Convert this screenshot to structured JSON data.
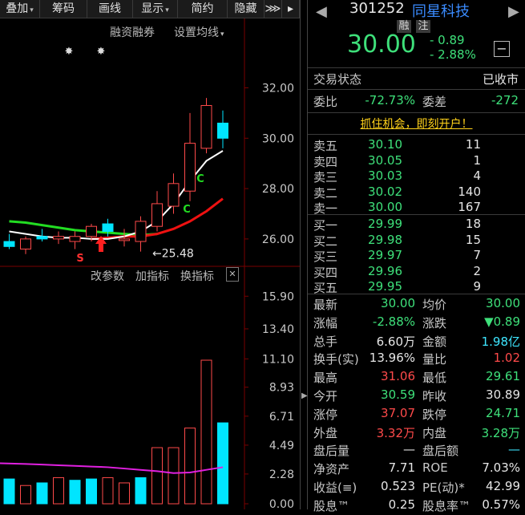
{
  "toolbar": {
    "items": [
      {
        "label": "叠加",
        "caret": "▾",
        "w": 50
      },
      {
        "label": "筹码",
        "caret": "",
        "w": 59
      },
      {
        "label": "画线",
        "caret": "",
        "w": 57
      },
      {
        "label": "显示",
        "caret": "▾",
        "w": 56
      },
      {
        "label": "简约",
        "caret": "",
        "w": 62
      },
      {
        "label": "隐藏",
        "caret": "",
        "w": 46
      },
      {
        "label": "⋙",
        "caret": "",
        "w": 22
      },
      {
        "label": "▸",
        "caret": "",
        "w": 22
      }
    ]
  },
  "chart_links": {
    "margin": "融资融券",
    "ma_setting": "设置均线",
    "ma_caret": "▾",
    "params": "改参数",
    "add_ind": "加指标",
    "swap_ind": "换指标",
    "close": "✕"
  },
  "chart_data": [
    {
      "type": "candlestick",
      "y_ticks": [
        "32.00",
        "30.00",
        "28.00",
        "26.00"
      ],
      "ylim": [
        25.2,
        33.8
      ],
      "annotation": "←25.48",
      "markers": [
        "✸",
        "✸",
        "S",
        "C",
        "C"
      ],
      "candles": [
        {
          "o": 25.9,
          "h": 26.2,
          "l": 25.6,
          "c": 25.7
        },
        {
          "o": 25.6,
          "h": 26.1,
          "l": 25.4,
          "c": 26.0
        },
        {
          "o": 26.1,
          "h": 26.4,
          "l": 25.9,
          "c": 26.0
        },
        {
          "o": 26.0,
          "h": 26.3,
          "l": 25.8,
          "c": 26.1
        },
        {
          "o": 25.9,
          "h": 26.3,
          "l": 25.6,
          "c": 26.1
        },
        {
          "o": 26.1,
          "h": 26.6,
          "l": 25.9,
          "c": 26.5
        },
        {
          "o": 26.6,
          "h": 26.8,
          "l": 26.1,
          "c": 26.3
        },
        {
          "o": 26.0,
          "h": 26.4,
          "l": 25.7,
          "c": 26.0
        },
        {
          "o": 25.9,
          "h": 26.9,
          "l": 25.5,
          "c": 26.7
        },
        {
          "o": 26.5,
          "h": 27.9,
          "l": 26.3,
          "c": 27.4
        },
        {
          "o": 27.3,
          "h": 28.6,
          "l": 27.0,
          "c": 28.2
        },
        {
          "o": 27.9,
          "h": 31.0,
          "l": 27.5,
          "c": 29.8
        },
        {
          "o": 29.6,
          "h": 31.6,
          "l": 29.4,
          "c": 31.3
        },
        {
          "o": 30.6,
          "h": 31.1,
          "l": 29.6,
          "c": 30.0
        }
      ],
      "ma_white": [
        26.3,
        26.2,
        26.1,
        26.05,
        26.05,
        26.0,
        26.0,
        26.1,
        26.3,
        26.7,
        27.4,
        28.3,
        29.1,
        29.5
      ],
      "ma_green": [
        26.7,
        26.65,
        26.55,
        26.45,
        26.35,
        26.3,
        26.25,
        26.2,
        26.15,
        26.2
      ],
      "ma_red": [
        26.0,
        26.05,
        26.1,
        26.1,
        26.2,
        26.4,
        26.7,
        27.1,
        27.6
      ]
    },
    {
      "type": "bar",
      "y_ticks": [
        "15.90",
        "13.40",
        "11.10",
        "8.93",
        "6.71",
        "4.49",
        "2.28",
        "0.00"
      ],
      "ylim": [
        0,
        16.9
      ],
      "volumes": [
        1.9,
        1.4,
        1.6,
        2.0,
        1.8,
        1.9,
        2.0,
        1.6,
        2.0,
        4.3,
        4.3,
        5.8,
        11.0,
        6.2
      ],
      "up": [
        false,
        true,
        false,
        true,
        false,
        false,
        true,
        true,
        false,
        true,
        true,
        true,
        true,
        false
      ],
      "ma_magenta": [
        3.1,
        3.05,
        3.0,
        2.95,
        2.9,
        2.85,
        2.8,
        2.7,
        2.6,
        2.5,
        2.35,
        2.4,
        2.6,
        2.8
      ]
    }
  ],
  "header": {
    "code": "301252",
    "name": "同星科技",
    "badge_margin": "融",
    "badge_note": "注",
    "price": "30.00",
    "change": "- 0.89",
    "change_pct": "- 2.88%",
    "minus_btn": "−"
  },
  "status": {
    "label": "交易状态",
    "value": "已收市"
  },
  "ratio": {
    "wb_label": "委比",
    "wb": "-72.73%",
    "wc_label": "委差",
    "wc": "-272"
  },
  "promo": "抓住机会，即刻开户！",
  "asks": [
    {
      "label": "卖五",
      "price": "30.10",
      "vol": "11"
    },
    {
      "label": "卖四",
      "price": "30.05",
      "vol": "1"
    },
    {
      "label": "卖三",
      "price": "30.03",
      "vol": "4"
    },
    {
      "label": "卖二",
      "price": "30.02",
      "vol": "140"
    },
    {
      "label": "卖一",
      "price": "30.00",
      "vol": "167"
    }
  ],
  "bids": [
    {
      "label": "买一",
      "price": "29.99",
      "vol": "18"
    },
    {
      "label": "买二",
      "price": "29.98",
      "vol": "15"
    },
    {
      "label": "买三",
      "price": "29.97",
      "vol": "7"
    },
    {
      "label": "买四",
      "price": "29.96",
      "vol": "2"
    },
    {
      "label": "买五",
      "price": "29.95",
      "vol": "9"
    }
  ],
  "stats": [
    {
      "l1": "最新",
      "v1": "30.00",
      "c1": "down",
      "l2": "均价",
      "v2": "30.00",
      "c2": "down"
    },
    {
      "l1": "涨幅",
      "v1": "-2.88%",
      "c1": "down",
      "l2": "涨跌",
      "v2": "▼0.89",
      "c2": "down"
    },
    {
      "l1": "总手",
      "v1": "6.60万",
      "c1": "white",
      "l2": "金额",
      "v2": "1.98亿",
      "c2": "cyan"
    },
    {
      "l1": "换手(实)",
      "v1": "13.96%",
      "c1": "white",
      "l2": "量比",
      "v2": "1.02",
      "c2": "up"
    },
    {
      "l1": "最高",
      "v1": "31.06",
      "c1": "up",
      "l2": "最低",
      "v2": "29.61",
      "c2": "down"
    },
    {
      "l1": "今开",
      "v1": "30.59",
      "c1": "down",
      "l2": "昨收",
      "v2": "30.89",
      "c2": "white"
    },
    {
      "l1": "涨停",
      "v1": "37.07",
      "c1": "up",
      "l2": "跌停",
      "v2": "24.71",
      "c2": "down"
    },
    {
      "l1": "外盘",
      "v1": "3.32万",
      "c1": "up",
      "l2": "内盘",
      "v2": "3.28万",
      "c2": "down"
    },
    {
      "l1": "盘后量",
      "v1": "—",
      "c1": "white",
      "l2": "盘后额",
      "v2": "—",
      "c2": "cyan"
    },
    {
      "l1": "净资产",
      "v1": "7.71",
      "c1": "white",
      "l2": "ROE",
      "v2": "7.03%",
      "c2": "white"
    },
    {
      "l1": "收益(≡)",
      "v1": "0.523",
      "c1": "white",
      "l2": "PE(动)*",
      "v2": "42.99",
      "c2": "white"
    },
    {
      "l1": "股息™",
      "v1": "0.25",
      "c1": "white",
      "l2": "股息率™",
      "v2": "0.57%",
      "c2": "white"
    }
  ],
  "colors": {
    "up": "#ff4a4a",
    "down": "#3ee07a",
    "cyan_bar": "#00e5ff",
    "ma_white": "#ffffff",
    "ma_green": "#22dd22",
    "ma_red": "#ee1111",
    "ma_magenta": "#e020e0"
  }
}
